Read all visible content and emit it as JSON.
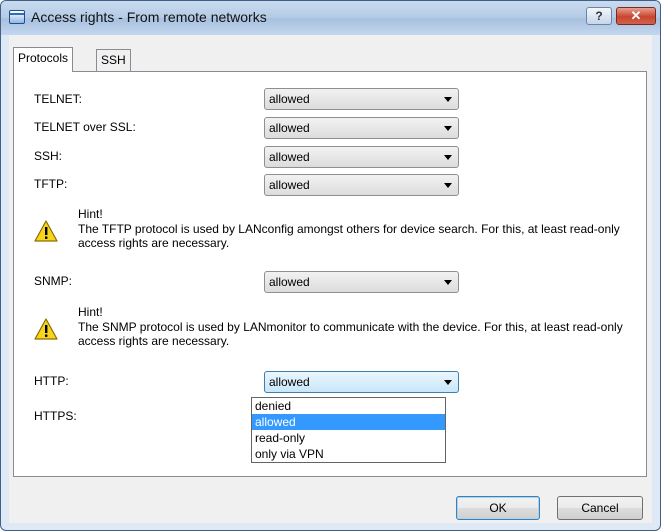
{
  "window": {
    "title": "Access rights - From remote networks"
  },
  "tabs": [
    {
      "label": "Protocols"
    },
    {
      "label": "SSH"
    }
  ],
  "rows": {
    "telnet": {
      "label": "TELNET:",
      "value": "allowed"
    },
    "telnet_ssl": {
      "label": "TELNET over SSL:",
      "value": "allowed"
    },
    "ssh": {
      "label": "SSH:",
      "value": "allowed"
    },
    "tftp": {
      "label": "TFTP:",
      "value": "allowed"
    },
    "snmp": {
      "label": "SNMP:",
      "value": "allowed"
    },
    "http": {
      "label": "HTTP:",
      "value": "allowed"
    },
    "https": {
      "label": "HTTPS:"
    }
  },
  "hints": [
    {
      "title": "Hint!",
      "text": "The TFTP protocol is used by LANconfig amongst others for device search. For this, at least read-only access rights are necessary."
    },
    {
      "title": "Hint!",
      "text": "The SNMP protocol is used by LANmonitor to communicate with the device. For this, at least read-only access rights are necessary."
    }
  ],
  "dropdown": {
    "options": [
      "denied",
      "allowed",
      "read-only",
      "only via VPN"
    ],
    "selected": "allowed"
  },
  "buttons": {
    "ok": "OK",
    "cancel": "Cancel",
    "help": "?",
    "close": "✕"
  },
  "icons": {
    "app": "window-icon",
    "hint": "warning-icon"
  },
  "colors": {
    "selection": "#3399ff",
    "close": "#c9452f"
  }
}
